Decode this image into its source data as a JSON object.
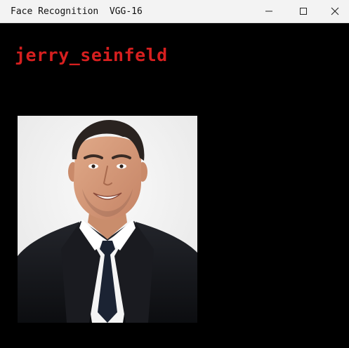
{
  "window": {
    "title": "Face Recognition  VGG-16",
    "controls": {
      "minimize_icon": "minimize-icon",
      "maximize_icon": "maximize-icon",
      "close_icon": "close-icon"
    }
  },
  "result": {
    "label": "jerry_seinfeld",
    "label_color": "#d61f1f"
  },
  "photo": {
    "subject": "portrait-photo",
    "background_color": "#f1f1f1",
    "suit_color": "#15161a",
    "shirt_color": "#f4f4f4",
    "tie_color": "#1b2333"
  },
  "colors": {
    "canvas": "#000000",
    "titlebar": "#f3f3f3"
  }
}
